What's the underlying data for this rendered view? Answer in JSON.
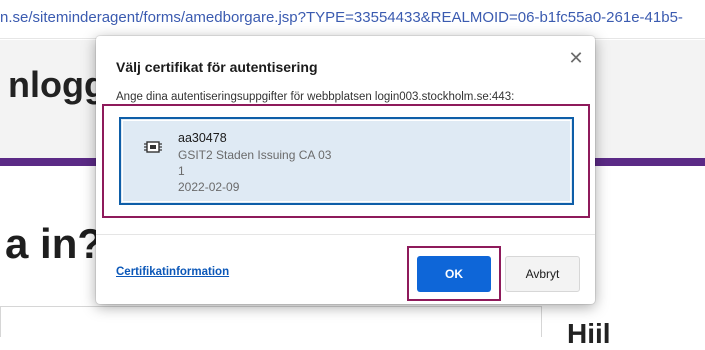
{
  "browser": {
    "url": "n.se/siteminderagent/forms/amedborgare.jsp?TYPE=33554433&REALMOID=06-b1fc55a0-261e-41b5-"
  },
  "page": {
    "header_title": "nloggr",
    "heading": "a in?",
    "side_heading": "Hiil"
  },
  "dialog": {
    "title": "Välj certifikat för autentisering",
    "close_icon": "close-icon",
    "description": "Ange dina autentiseringsuppgifter för webbplatsen login003.stockholm.se:443:",
    "certificate": {
      "icon": "certificate-chip-icon",
      "name": "aa30478",
      "issuer": "GSIT2 Staden Issuing CA 03",
      "index": "1",
      "date": "2022-02-09"
    },
    "cert_info_link": "Certifikatinformation",
    "ok_label": "OK",
    "cancel_label": "Avbryt"
  },
  "colors": {
    "accent": "#0e66d8",
    "selection_bg": "#dfeaf4",
    "selection_border": "#0e5ea8",
    "highlight": "#8e1a5b",
    "brand_purple": "#5b2a86",
    "link": "#0b57b8"
  }
}
